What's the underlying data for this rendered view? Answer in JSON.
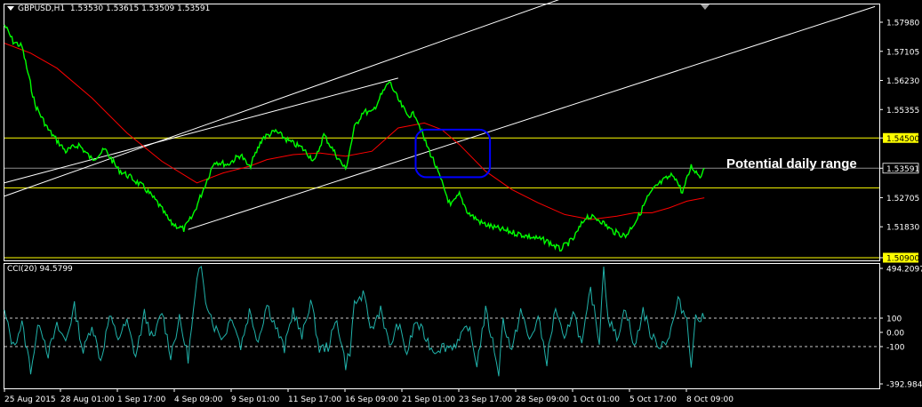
{
  "header": {
    "symbol_timeframe": "GBPUSD,H1",
    "ohlc": "1.53530 1.53615 1.53509 1.53591"
  },
  "annotation": "Potential daily range",
  "colors": {
    "background": "#000000",
    "price": "#00ff00",
    "moving_average": "#ff0000",
    "channel": "#ffffff",
    "levels": "#ffff00",
    "highlight_box": "#0000ff",
    "cci": "#20b2aa",
    "price_tag": "#ffff00"
  },
  "icons": [
    "dropdown-triangle-icon",
    "shift-marker-icon"
  ],
  "chart_data": [
    {
      "type": "line",
      "panel": "price",
      "title": "GBPUSD,H1",
      "y_axis_ticks": [
        "1.57980",
        "1.57105",
        "1.56230",
        "1.55355",
        "1.54500",
        "1.53591",
        "1.52705",
        "1.51830",
        "1.50900"
      ],
      "ylim": [
        1.509,
        1.5826
      ],
      "x_ticks": [
        "25 Aug 2015",
        "28 Aug 01:00",
        "1 Sep 17:00",
        "4 Sep 09:00",
        "9 Sep 01:00",
        "11 Sep 17:00",
        "16 Sep 09:00",
        "21 Sep 01:00",
        "23 Sep 17:00",
        "28 Sep 09:00",
        "1 Oct 01:00",
        "5 Oct 17:00",
        "8 Oct 09:00"
      ],
      "horizontal_levels": [
        {
          "value": 1.545,
          "label": "1.54500"
        },
        {
          "value": 1.53,
          "label": "1.53000"
        },
        {
          "value": 1.509,
          "label": "1.50900"
        }
      ],
      "current_price": {
        "value": 1.53591,
        "label": "1.53591"
      },
      "series": [
        {
          "kind": "price",
          "x": [
            0,
            0.01,
            0.02,
            0.035,
            0.05,
            0.07,
            0.085,
            0.1,
            0.115,
            0.13,
            0.145,
            0.16,
            0.175,
            0.19,
            0.205,
            0.215,
            0.225,
            0.24,
            0.255,
            0.27,
            0.28,
            0.295,
            0.31,
            0.325,
            0.34,
            0.355,
            0.365,
            0.38,
            0.39,
            0.4,
            0.41,
            0.42,
            0.43,
            0.44,
            0.45,
            0.46,
            0.47,
            0.48,
            0.49,
            0.5,
            0.51,
            0.52,
            0.53,
            0.545,
            0.56,
            0.575,
            0.59,
            0.605,
            0.62,
            0.635,
            0.65,
            0.665,
            0.68,
            0.695,
            0.71,
            0.725,
            0.735,
            0.745,
            0.755,
            0.765,
            0.775,
            0.785,
            0.795,
            0.8
          ],
          "values": [
            1.579,
            1.574,
            1.5725,
            1.555,
            1.5475,
            1.541,
            1.543,
            1.5385,
            1.5415,
            1.5355,
            1.533,
            1.53,
            1.5255,
            1.5195,
            1.5175,
            1.5215,
            1.528,
            1.538,
            1.537,
            1.54,
            1.536,
            1.545,
            1.547,
            1.544,
            1.542,
            1.538,
            1.546,
            1.5395,
            1.5355,
            1.548,
            1.553,
            1.5525,
            1.5575,
            1.562,
            1.5565,
            1.552,
            1.552,
            1.5445,
            1.5385,
            1.5315,
            1.5245,
            1.528,
            1.5225,
            1.5195,
            1.518,
            1.517,
            1.516,
            1.515,
            1.514,
            1.5115,
            1.5145,
            1.5215,
            1.5205,
            1.517,
            1.5155,
            1.5215,
            1.527,
            1.5305,
            1.5325,
            1.534,
            1.5285,
            1.5365,
            1.5335,
            1.5359
          ]
        },
        {
          "kind": "moving_average",
          "x": [
            0,
            0.03,
            0.06,
            0.1,
            0.14,
            0.18,
            0.22,
            0.25,
            0.28,
            0.3,
            0.33,
            0.36,
            0.39,
            0.42,
            0.45,
            0.48,
            0.5,
            0.52,
            0.55,
            0.58,
            0.61,
            0.64,
            0.67,
            0.7,
            0.72,
            0.74,
            0.76,
            0.78,
            0.8
          ],
          "values": [
            1.5735,
            1.5705,
            1.566,
            1.557,
            1.5465,
            1.538,
            1.5315,
            1.5345,
            1.5365,
            1.5385,
            1.54,
            1.5405,
            1.5395,
            1.541,
            1.548,
            1.5495,
            1.5475,
            1.543,
            1.535,
            1.5295,
            1.5255,
            1.522,
            1.5205,
            1.5215,
            1.5225,
            1.5225,
            1.524,
            1.526,
            1.527
          ]
        }
      ],
      "trend_lines": [
        {
          "from": {
            "x": 0.0,
            "price": 1.5275
          },
          "to": {
            "x": 0.665,
            "price": 1.5895
          }
        },
        {
          "from": {
            "x": 0.21,
            "price": 1.5175
          },
          "to": {
            "x": 0.995,
            "price": 1.5845
          }
        },
        {
          "from": {
            "x": 0.0,
            "price": 1.5315
          },
          "to": {
            "x": 0.45,
            "price": 1.563
          }
        }
      ],
      "highlight_region": {
        "x": [
          0.47,
          0.555
        ],
        "price": [
          1.5332,
          1.5475
        ]
      }
    },
    {
      "type": "line",
      "panel": "indicator",
      "title": "CCI(20) 94.5799",
      "y_axis_ticks": [
        "494.2097",
        "100",
        "0.00",
        "-100",
        "-392.9844"
      ],
      "ylim": [
        -392.9844,
        494.2097
      ],
      "reference_levels": [
        100,
        -100
      ],
      "series": [
        {
          "name": "CCI(20)",
          "x": [
            0,
            0.01,
            0.02,
            0.03,
            0.04,
            0.05,
            0.06,
            0.07,
            0.08,
            0.09,
            0.1,
            0.11,
            0.12,
            0.13,
            0.14,
            0.15,
            0.16,
            0.17,
            0.18,
            0.19,
            0.2,
            0.21,
            0.22,
            0.225,
            0.23,
            0.24,
            0.25,
            0.26,
            0.27,
            0.28,
            0.29,
            0.3,
            0.31,
            0.32,
            0.33,
            0.34,
            0.35,
            0.36,
            0.37,
            0.38,
            0.39,
            0.395,
            0.4,
            0.41,
            0.42,
            0.43,
            0.44,
            0.45,
            0.46,
            0.47,
            0.48,
            0.49,
            0.5,
            0.51,
            0.52,
            0.53,
            0.54,
            0.55,
            0.56,
            0.565,
            0.57,
            0.58,
            0.59,
            0.6,
            0.61,
            0.62,
            0.63,
            0.64,
            0.65,
            0.66,
            0.67,
            0.68,
            0.685,
            0.69,
            0.7,
            0.71,
            0.72,
            0.73,
            0.74,
            0.75,
            0.76,
            0.77,
            0.78,
            0.785,
            0.79,
            0.8
          ],
          "values": [
            140,
            -100,
            60,
            -260,
            80,
            -150,
            40,
            -60,
            180,
            -140,
            60,
            -200,
            110,
            -40,
            70,
            -170,
            130,
            -60,
            150,
            -160,
            90,
            -180,
            350,
            480,
            240,
            40,
            -40,
            120,
            -100,
            150,
            -60,
            200,
            40,
            -120,
            160,
            -40,
            230,
            -120,
            -100,
            90,
            -230,
            -130,
            200,
            260,
            10,
            180,
            -110,
            60,
            -150,
            80,
            -20,
            -130,
            -100,
            -100,
            -60,
            50,
            -220,
            150,
            -120,
            -280,
            90,
            -140,
            160,
            -60,
            100,
            -200,
            180,
            -80,
            170,
            -100,
            300,
            -60,
            490,
            100,
            -40,
            180,
            -120,
            160,
            -40,
            -90,
            -30,
            220,
            100,
            -210,
            100,
            95
          ]
        }
      ]
    }
  ]
}
